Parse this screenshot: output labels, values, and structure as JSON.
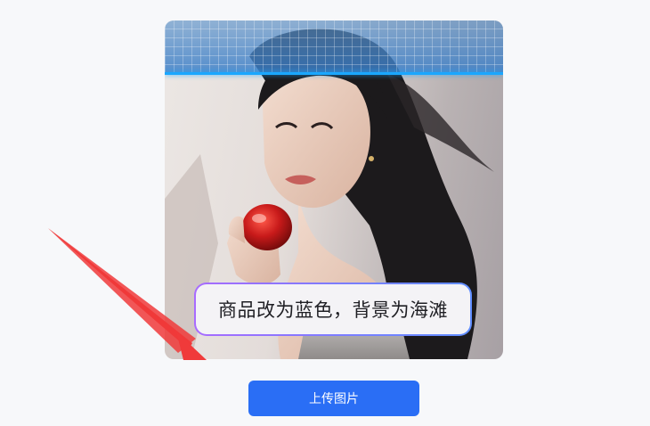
{
  "prompt": {
    "text": "商品改为蓝色，背景为海滩"
  },
  "upload": {
    "label": "上传图片"
  },
  "colors": {
    "accent": "#2a6ef5",
    "scan_line": "#1aa7ff",
    "arrow": "#f03a3a",
    "product": "#c81a1a"
  }
}
